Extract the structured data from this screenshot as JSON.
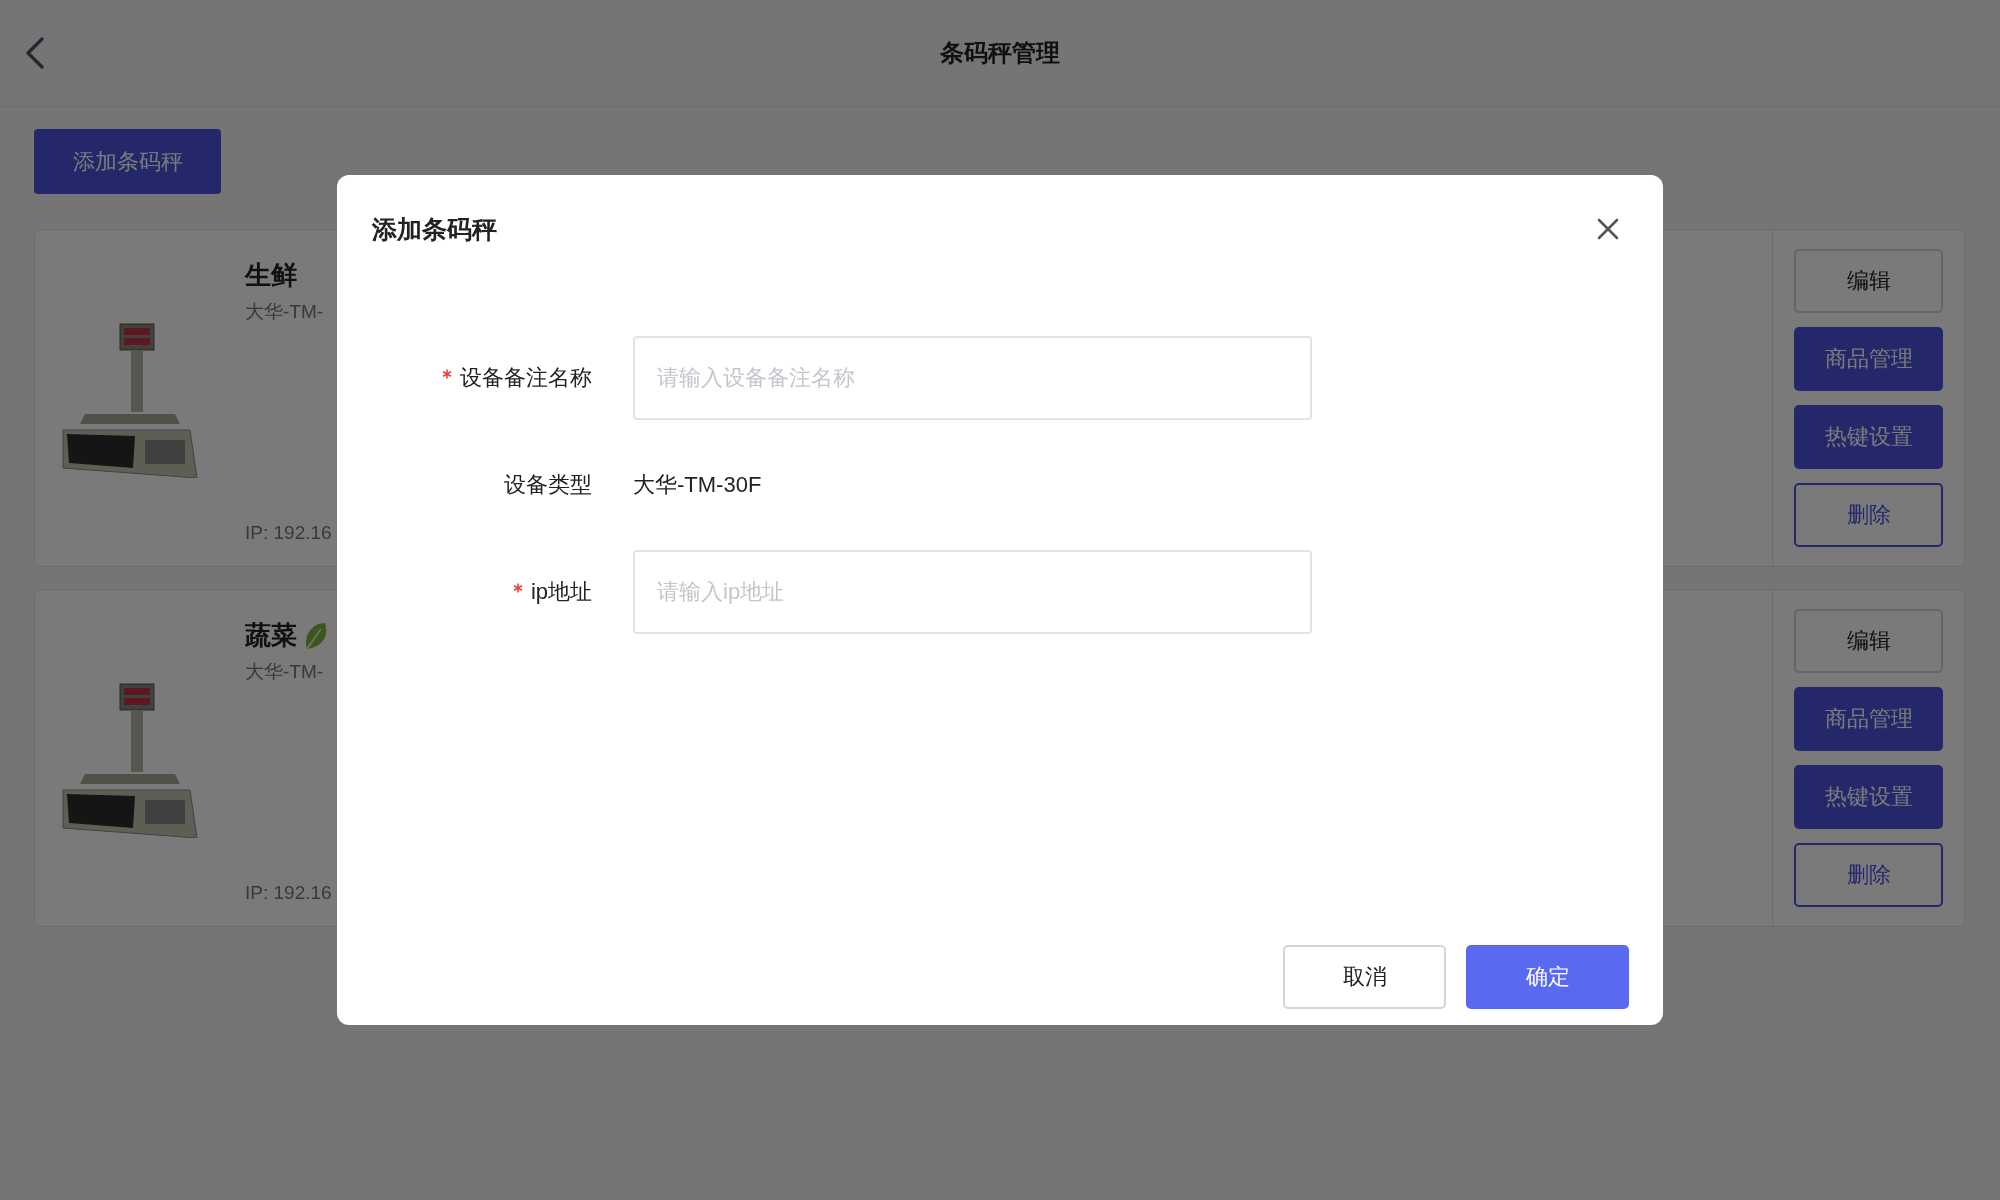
{
  "header": {
    "title": "条码秤管理"
  },
  "add_button": "添加条码秤",
  "scales": [
    {
      "name": "生鲜",
      "kind": "plain",
      "model": "大华-TM-",
      "ip": "IP: 192.16",
      "actions": [
        {
          "label": "编辑",
          "kind": "outline"
        },
        {
          "label": "商品管理",
          "kind": "primary"
        },
        {
          "label": "热键设置",
          "kind": "primary"
        },
        {
          "label": "删除",
          "kind": "accent-outline"
        }
      ]
    },
    {
      "name": "蔬菜",
      "kind": "leaf",
      "model": "大华-TM-",
      "ip": "IP: 192.16",
      "actions": [
        {
          "label": "编辑",
          "kind": "outline"
        },
        {
          "label": "商品管理",
          "kind": "primary"
        },
        {
          "label": "热键设置",
          "kind": "primary"
        },
        {
          "label": "删除",
          "kind": "accent-outline"
        }
      ]
    }
  ],
  "dialog": {
    "title": "添加条码秤",
    "fields": [
      {
        "kind": "input",
        "label": "设备备注名称",
        "required": true,
        "placeholder": "请输入设备备注名称"
      },
      {
        "kind": "text",
        "label": "设备类型",
        "required": false,
        "value": "大华-TM-30F"
      },
      {
        "kind": "input",
        "label": "ip地址",
        "required": true,
        "placeholder": "请输入ip地址"
      }
    ],
    "buttons": [
      {
        "label": "取消",
        "kind": "default"
      },
      {
        "label": "确定",
        "kind": "primary"
      }
    ]
  }
}
